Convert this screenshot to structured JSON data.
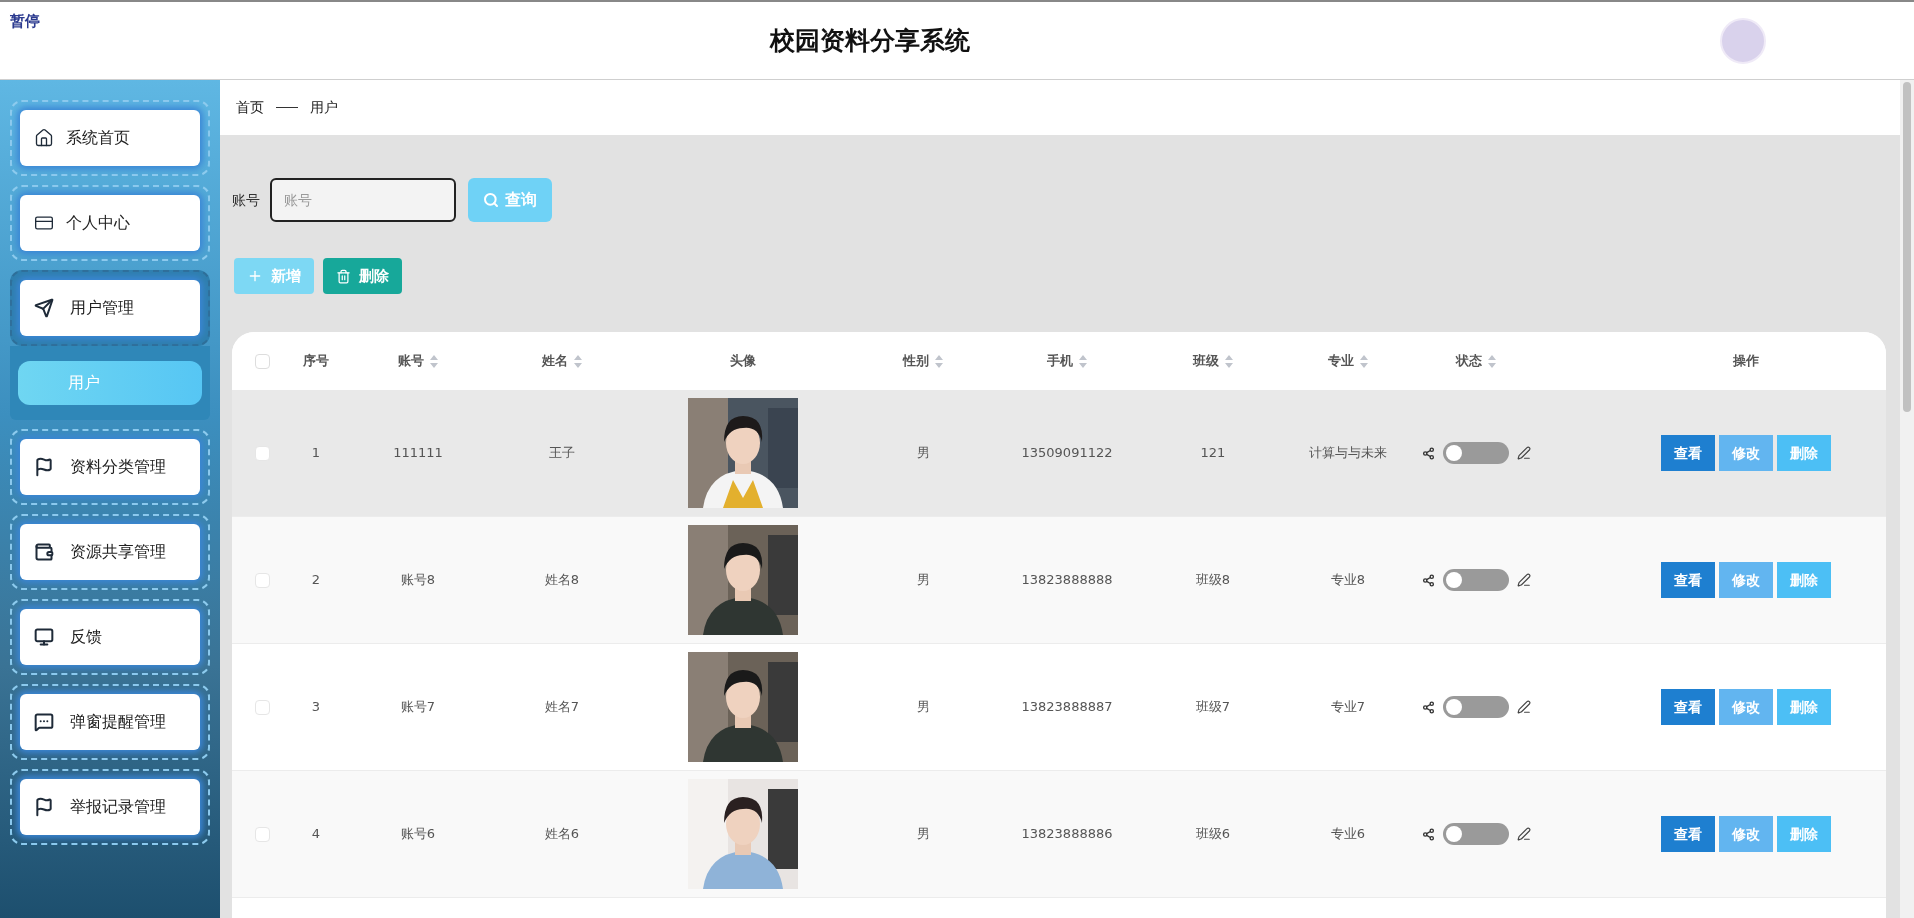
{
  "overlay_label": "暂停",
  "header": {
    "title": "校园资料分享系统"
  },
  "sidebar": {
    "items": [
      {
        "label": "系统首页",
        "expanded": false
      },
      {
        "label": "个人中心",
        "expanded": false
      },
      {
        "label": "用户管理",
        "expanded": true,
        "children": [
          {
            "label": "用户",
            "selected": true
          }
        ]
      },
      {
        "label": "资料分类管理",
        "expanded": false
      },
      {
        "label": "资源共享管理",
        "expanded": false
      },
      {
        "label": "反馈",
        "expanded": false
      },
      {
        "label": "弹窗提醒管理",
        "expanded": false
      },
      {
        "label": "举报记录管理",
        "expanded": false
      }
    ]
  },
  "breadcrumb": [
    "首页",
    "用户"
  ],
  "search": {
    "label": "账号",
    "placeholder": "账号",
    "button": "查询"
  },
  "toolbar": {
    "add": "新增",
    "delete": "删除"
  },
  "table": {
    "select_all_checked": false,
    "columns": [
      {
        "label": "序号",
        "sortable": false
      },
      {
        "label": "账号",
        "sortable": true
      },
      {
        "label": "姓名",
        "sortable": true
      },
      {
        "label": "头像",
        "sortable": false
      },
      {
        "label": "性别",
        "sortable": true
      },
      {
        "label": "手机",
        "sortable": true
      },
      {
        "label": "班级",
        "sortable": true
      },
      {
        "label": "专业",
        "sortable": true
      },
      {
        "label": "状态",
        "sortable": true
      },
      {
        "label": "操作",
        "sortable": false
      }
    ],
    "rows": [
      {
        "checked": false,
        "highlighted": true,
        "index": "1",
        "account": "111111",
        "name": "王子",
        "avatar": {
          "kind": "picture"
        },
        "gender": "男",
        "phone": "13509091122",
        "class": "121",
        "major": "计算与与未来",
        "on": false,
        "actions": [
          "查看",
          "修改",
          "删除"
        ]
      },
      {
        "checked": false,
        "highlighted": false,
        "index": "2",
        "account": "账号8",
        "name": "姓名8",
        "avatar": {
          "kind": "picture"
        },
        "gender": "男",
        "phone": "13823888888",
        "class": "班级8",
        "major": "专业8",
        "on": false,
        "actions": [
          "查看",
          "修改",
          "删除"
        ]
      },
      {
        "checked": false,
        "highlighted": false,
        "index": "3",
        "account": "账号7",
        "name": "姓名7",
        "avatar": {
          "kind": "picture"
        },
        "gender": "男",
        "phone": "13823888887",
        "class": "班级7",
        "major": "专业7",
        "on": false,
        "actions": [
          "查看",
          "修改",
          "删除"
        ]
      },
      {
        "checked": false,
        "highlighted": false,
        "index": "4",
        "account": "账号6",
        "name": "姓名6",
        "avatar": {
          "kind": "picture"
        },
        "gender": "男",
        "phone": "13823888886",
        "class": "班级6",
        "major": "专业6",
        "on": false,
        "actions": [
          "查看",
          "修改",
          "删除"
        ]
      }
    ]
  }
}
